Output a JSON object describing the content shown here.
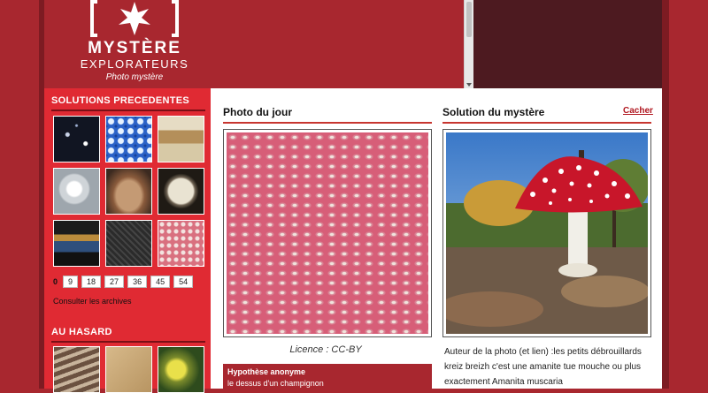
{
  "logo": {
    "title": "MYSTÈRE",
    "subtitle": "EXPLORATEURS",
    "tagline": "Photo mystère"
  },
  "sidebar": {
    "previous_heading": "Solutions precedentes",
    "thumbnails": [
      "sparkle-texture",
      "blue-dots",
      "tapestry",
      "glass-dome",
      "rock-mound",
      "round-object",
      "instrument-box",
      "dark-texture",
      "pink-dots"
    ],
    "pagination": {
      "current": "0",
      "pages": [
        "9",
        "18",
        "27",
        "36",
        "45",
        "54"
      ]
    },
    "archives_link": "Consulter les archives",
    "random_heading": "Au hasard",
    "random_thumbnails": [
      "drill-spiral",
      "sand-fabric",
      "yellow-flowers"
    ]
  },
  "photo_of_day": {
    "heading": "Photo du jour",
    "license": "Licence : CC-BY",
    "hypothesis_title": "Hypothèse anonyme",
    "hypothesis_text": "le dessus d'un champignon"
  },
  "solution": {
    "heading": "Solution du mystère",
    "hide_link": "Cacher",
    "text": "Auteur de la photo (et lien) :les petits débrouillards kreiz breizh c'est une amanite tue mouche ou plus exactement Amanita muscaria"
  },
  "colors": {
    "brand_red": "#a8272f",
    "sidebar_red": "#e02a33",
    "dark_maroon": "#4d1a20"
  }
}
